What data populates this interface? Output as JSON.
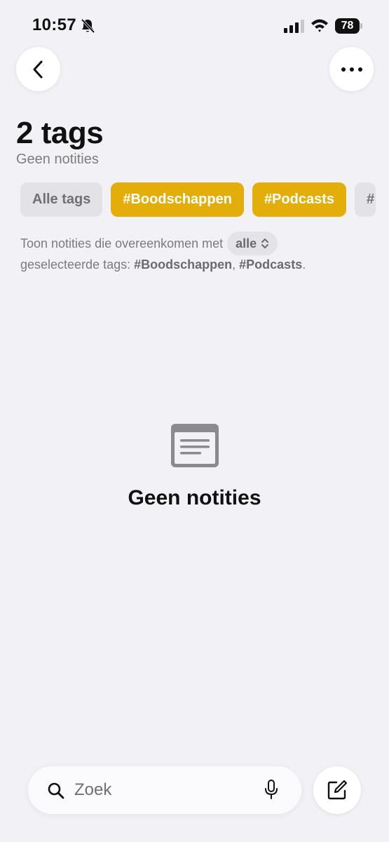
{
  "status_bar": {
    "time": "10:57",
    "battery": "78",
    "icons": [
      "bell-slash-icon",
      "signal-icon",
      "wifi-icon",
      "battery-icon"
    ]
  },
  "nav": {
    "back_icon": "chevron-left-icon",
    "more_icon": "ellipsis-icon"
  },
  "header": {
    "title": "2 tags",
    "subtitle": "Geen notities"
  },
  "chips": [
    {
      "label": "Alle tags",
      "active": false
    },
    {
      "label": "#Boodschappen",
      "active": true
    },
    {
      "label": "#Podcasts",
      "active": true
    },
    {
      "label": "#",
      "active": false
    }
  ],
  "filter": {
    "prefix": "Toon notities die overeenkomen met",
    "mode": "alle",
    "line2_prefix": "geselecteerde tags: ",
    "tag1": "#Boodschappen",
    "separator": ", ",
    "tag2": "#Podcasts",
    "suffix": "."
  },
  "empty_state": {
    "icon": "note-icon",
    "text": "Geen notities"
  },
  "search": {
    "placeholder": "Zoek",
    "value": "",
    "icons": [
      "search-icon",
      "mic-icon"
    ]
  },
  "compose": {
    "icon": "compose-icon"
  },
  "colors": {
    "background": "#f2f1f6",
    "accent": "#e4ae0a",
    "chip_neutral": "#e2e2e7"
  }
}
